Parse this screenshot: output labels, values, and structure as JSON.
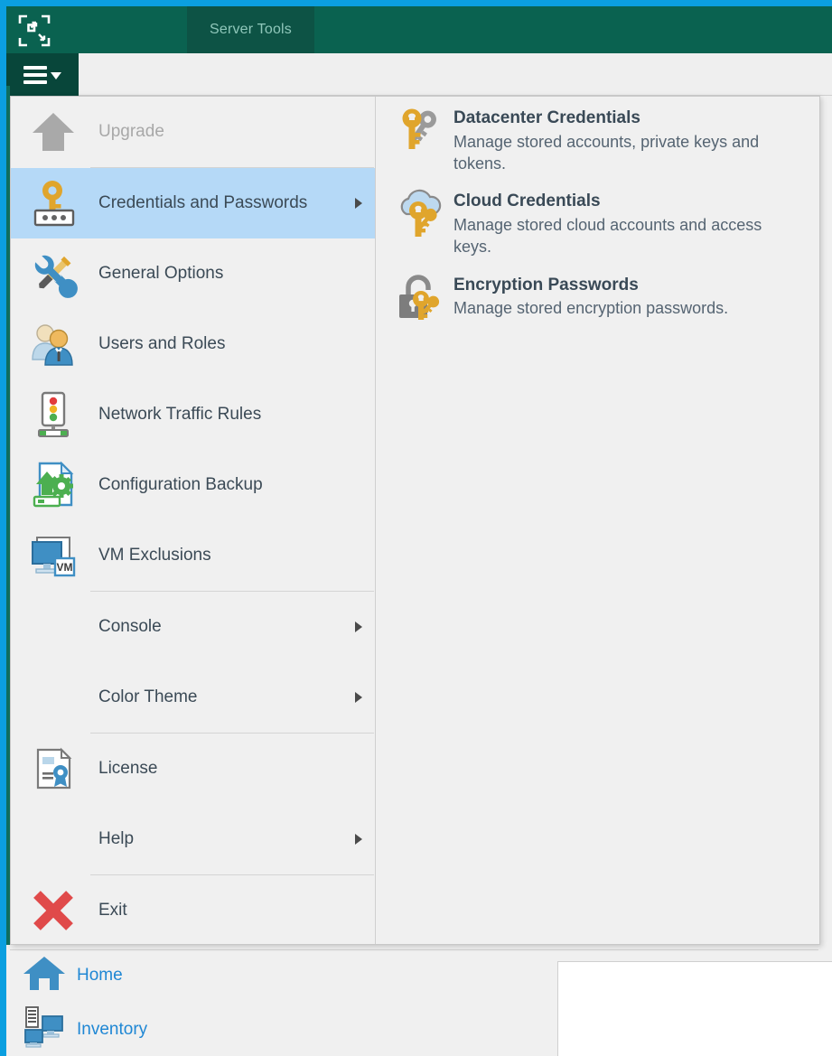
{
  "window": {
    "accent_blue": "#0b9fe0",
    "ribbon_green": "#0a6250",
    "tab_green": "#0d5345",
    "menu_button_green": "#08463a",
    "selection_blue": "#b5d9f7"
  },
  "ribbon": {
    "logo_icon": "veeam-brackets-logo-icon",
    "tabs": [
      {
        "label": "Server Tools",
        "active": true
      }
    ],
    "main_menu_button": {
      "icon": "hamburger-menu-icon",
      "caret": "chevron-down-icon"
    }
  },
  "main_menu": {
    "items": [
      {
        "label": "Upgrade",
        "icon": "upgrade-arrow-icon",
        "disabled": true,
        "submenu": false,
        "selected": false
      },
      {
        "label": "Credentials and Passwords",
        "icon": "key-password-icon",
        "disabled": false,
        "submenu": true,
        "selected": true
      },
      {
        "label": "General Options",
        "icon": "wrench-screwdriver-icon",
        "disabled": false,
        "submenu": false,
        "selected": false
      },
      {
        "label": "Users and Roles",
        "icon": "users-group-icon",
        "disabled": false,
        "submenu": false,
        "selected": false
      },
      {
        "label": "Network Traffic Rules",
        "icon": "traffic-light-icon",
        "disabled": false,
        "submenu": false,
        "selected": false
      },
      {
        "label": "Configuration Backup",
        "icon": "config-backup-gear-icon",
        "disabled": false,
        "submenu": false,
        "selected": false
      },
      {
        "label": "VM Exclusions",
        "icon": "vm-monitor-icon",
        "disabled": false,
        "submenu": false,
        "selected": false
      },
      {
        "label": "Console",
        "icon": "",
        "disabled": false,
        "submenu": true,
        "selected": false
      },
      {
        "label": "Color Theme",
        "icon": "",
        "disabled": false,
        "submenu": true,
        "selected": false
      },
      {
        "label": "License",
        "icon": "license-document-icon",
        "disabled": false,
        "submenu": false,
        "selected": false
      },
      {
        "label": "Help",
        "icon": "",
        "disabled": false,
        "submenu": true,
        "selected": false
      },
      {
        "label": "Exit",
        "icon": "exit-cross-icon",
        "disabled": false,
        "submenu": false,
        "selected": false
      }
    ]
  },
  "submenu": {
    "title": "Credentials and Passwords",
    "items": [
      {
        "label": "Datacenter Credentials",
        "description": "Manage stored accounts, private keys and tokens.",
        "icon": "two-keys-icon"
      },
      {
        "label": "Cloud Credentials",
        "description": "Manage stored cloud accounts and access keys.",
        "icon": "cloud-key-icon"
      },
      {
        "label": "Encryption Passwords",
        "description": "Manage stored encryption passwords.",
        "icon": "padlock-key-icon"
      }
    ]
  },
  "bottom_nav": {
    "items": [
      {
        "label": "Home",
        "icon": "home-icon"
      },
      {
        "label": "Inventory",
        "icon": "inventory-servers-icon"
      }
    ]
  }
}
